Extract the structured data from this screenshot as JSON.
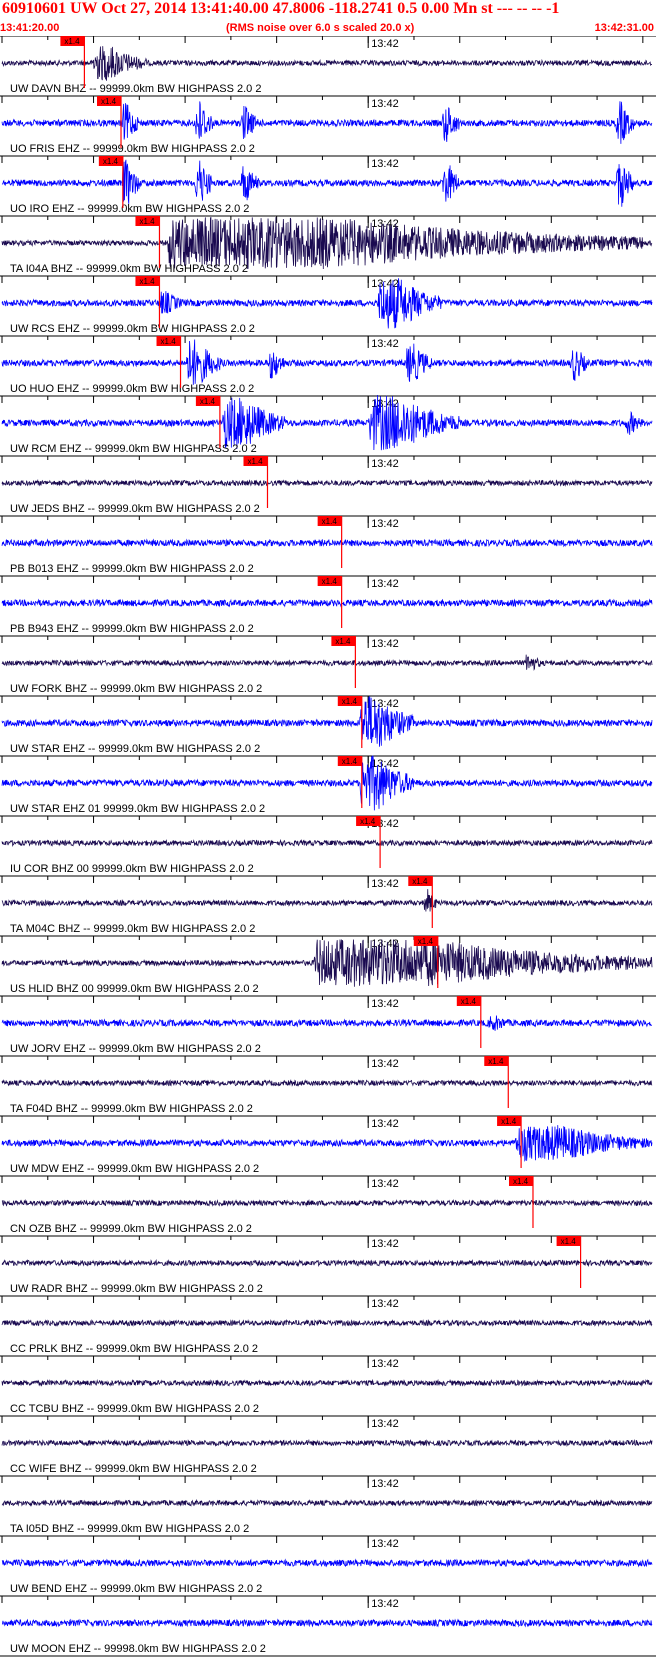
{
  "header": {
    "title": "60910601 UW Oct 27, 2014 13:41:40.00   47.8006 -118.2741  0.5 0.00 Mn st --- -- --  -1",
    "start_time": "13:41:20.00",
    "rms_note": "(RMS noise over 6.0 s scaled 20.0 x)",
    "end_time": "13:42:31.00"
  },
  "colors": {
    "header_text": "#ff0000",
    "pick_marker": "#ff0000",
    "trace_dark": "#1a0a50",
    "trace_blue": "#0000ff",
    "axis": "#000000"
  },
  "chart_data": {
    "type": "line",
    "x_start": "13:41:20.00",
    "x_end": "13:42:31.00",
    "minute_tick_label": "13:42",
    "pick_label": "x1.4",
    "traces": [
      {
        "label": "UW DAVN BHZ -- 99999.0km BW  HIGHPASS  2.0  2",
        "color": "dark",
        "pick_time": "13:41:29.0",
        "events": [
          {
            "t": 9.8,
            "amp": 18,
            "dur": 6
          }
        ]
      },
      {
        "label": "UO FRIS EHZ -- 99999.0km BW  HIGHPASS  2.0  2",
        "color": "blue",
        "pick_time": "13:41:33.0",
        "events": [
          {
            "t": 13,
            "amp": 20,
            "dur": 2
          },
          {
            "t": 21,
            "amp": 24,
            "dur": 2
          },
          {
            "t": 26,
            "amp": 18,
            "dur": 2
          },
          {
            "t": 48,
            "amp": 20,
            "dur": 2
          },
          {
            "t": 67,
            "amp": 22,
            "dur": 2
          }
        ]
      },
      {
        "label": "UO IRO EHZ -- 99999.0km BW  HIGHPASS  2.0  2",
        "color": "blue",
        "pick_time": "13:41:33.2",
        "events": [
          {
            "t": 13,
            "amp": 24,
            "dur": 2
          },
          {
            "t": 21,
            "amp": 24,
            "dur": 2
          },
          {
            "t": 26,
            "amp": 20,
            "dur": 2
          },
          {
            "t": 48,
            "amp": 22,
            "dur": 2
          },
          {
            "t": 67,
            "amp": 24,
            "dur": 2
          }
        ]
      },
      {
        "label": "TA I04A BHZ -- 99999.0km BW  HIGHPASS  2.0  2",
        "color": "dark",
        "pick_time": "13:41:37.2",
        "events": [
          {
            "t": 18,
            "amp": 26,
            "dur": 52
          }
        ]
      },
      {
        "label": "UW RCS EHZ -- 99999.0km BW  HIGHPASS  2.0  2",
        "color": "blue",
        "pick_time": "13:41:37.2",
        "events": [
          {
            "t": 17,
            "amp": 12,
            "dur": 3
          },
          {
            "t": 41,
            "amp": 26,
            "dur": 7
          }
        ]
      },
      {
        "label": "UO HUO EHZ -- 99999.0km BW  HIGHPASS  2.0  2",
        "color": "blue",
        "pick_time": "13:41:39.5",
        "events": [
          {
            "t": 20,
            "amp": 24,
            "dur": 4
          },
          {
            "t": 29,
            "amp": 16,
            "dur": 2
          },
          {
            "t": 44,
            "amp": 20,
            "dur": 3
          },
          {
            "t": 62,
            "amp": 18,
            "dur": 2
          }
        ]
      },
      {
        "label": "UW RCM EHZ -- 99999.0km BW  HIGHPASS  2.0  2",
        "color": "blue",
        "pick_time": "13:41:43.8",
        "events": [
          {
            "t": 24,
            "amp": 26,
            "dur": 7
          },
          {
            "t": 40,
            "amp": 28,
            "dur": 10
          },
          {
            "t": 68,
            "amp": 12,
            "dur": 2
          }
        ]
      },
      {
        "label": "UW JEDS BHZ -- 99999.0km BW  HIGHPASS  2.0  2",
        "color": "dark",
        "pick_time": "13:41:49.0",
        "events": []
      },
      {
        "label": "PB B013 EHZ -- 99999.0km BW  HIGHPASS  2.0  2",
        "color": "blue",
        "pick_time": "13:41:57.1",
        "events": []
      },
      {
        "label": "PB B943 EHZ -- 99999.0km BW  HIGHPASS  2.0  2",
        "color": "blue",
        "pick_time": "13:41:57.1",
        "events": []
      },
      {
        "label": "UW FORK BHZ -- 99999.0km BW  HIGHPASS  2.0  2",
        "color": "dark",
        "pick_time": "13:41:58.6",
        "events": [
          {
            "t": 57,
            "amp": 10,
            "dur": 2
          }
        ]
      },
      {
        "label": "UW STAR EHZ -- 99999.0km BW  HIGHPASS  2.0  2",
        "color": "blue",
        "pick_time": "13:41:59.3",
        "events": [
          {
            "t": 39,
            "amp": 28,
            "dur": 6
          }
        ]
      },
      {
        "label": "UW STAR EHZ 01 99999.0km BW  HIGHPASS  2.0  2",
        "color": "blue",
        "pick_time": "13:41:59.3",
        "events": [
          {
            "t": 39,
            "amp": 28,
            "dur": 6
          }
        ]
      },
      {
        "label": "IU COR BHZ 00 99999.0km BW  HIGHPASS  2.0  2",
        "color": "dark",
        "pick_time": "13:42:01.3",
        "events": []
      },
      {
        "label": "TA M04C BHZ -- 99999.0km BW  HIGHPASS  2.0  2",
        "color": "dark",
        "pick_time": "13:42:07.0",
        "events": [
          {
            "t": 46,
            "amp": 14,
            "dur": 1.5
          }
        ]
      },
      {
        "label": "US HLID BHZ 00 99999.0km BW  HIGHPASS  2.0  2",
        "color": "dark",
        "pick_time": "13:42:07.6",
        "events": [
          {
            "t": 34,
            "amp": 24,
            "dur": 37
          }
        ]
      },
      {
        "label": "UW JORV EHZ -- 99999.0km BW  HIGHPASS  2.0  2",
        "color": "blue",
        "pick_time": "13:42:12.3",
        "events": [
          {
            "t": 53,
            "amp": 8,
            "dur": 3
          }
        ]
      },
      {
        "label": "TA F04D BHZ -- 99999.0km BW  HIGHPASS  2.0  2",
        "color": "dark",
        "pick_time": "13:42:15.3",
        "events": []
      },
      {
        "label": "UW MDW EHZ -- 99999.0km BW  HIGHPASS  2.0  2",
        "color": "blue",
        "pick_time": "13:42:16.7",
        "events": [
          {
            "t": 56,
            "amp": 18,
            "dur": 15
          }
        ]
      },
      {
        "label": "CN OZB BHZ -- 99999.0km BW  HIGHPASS  2.0  2",
        "color": "dark",
        "pick_time": "13:42:18.0",
        "events": []
      },
      {
        "label": "UW RADR BHZ -- 99999.0km BW  HIGHPASS  2.0  2",
        "color": "dark",
        "pick_time": "13:42:23.2",
        "events": []
      },
      {
        "label": "CC PRLK BHZ -- 99999.0km BW  HIGHPASS  2.0  2",
        "color": "dark",
        "pick_time": null,
        "events": []
      },
      {
        "label": "CC TCBU BHZ -- 99999.0km BW  HIGHPASS  2.0  2",
        "color": "dark",
        "pick_time": null,
        "events": []
      },
      {
        "label": "CC WIFE BHZ -- 99999.0km BW  HIGHPASS  2.0  2",
        "color": "dark",
        "pick_time": null,
        "events": []
      },
      {
        "label": "TA I05D BHZ -- 99999.0km BW  HIGHPASS  2.0  2",
        "color": "dark",
        "pick_time": null,
        "events": []
      },
      {
        "label": "UW BEND EHZ -- 99999.0km BW  HIGHPASS  2.0  2",
        "color": "blue",
        "pick_time": null,
        "events": []
      },
      {
        "label": "UW MOON EHZ -- 99998.0km BW  HIGHPASS  2.0  2",
        "color": "blue",
        "pick_time": null,
        "events": []
      }
    ]
  }
}
